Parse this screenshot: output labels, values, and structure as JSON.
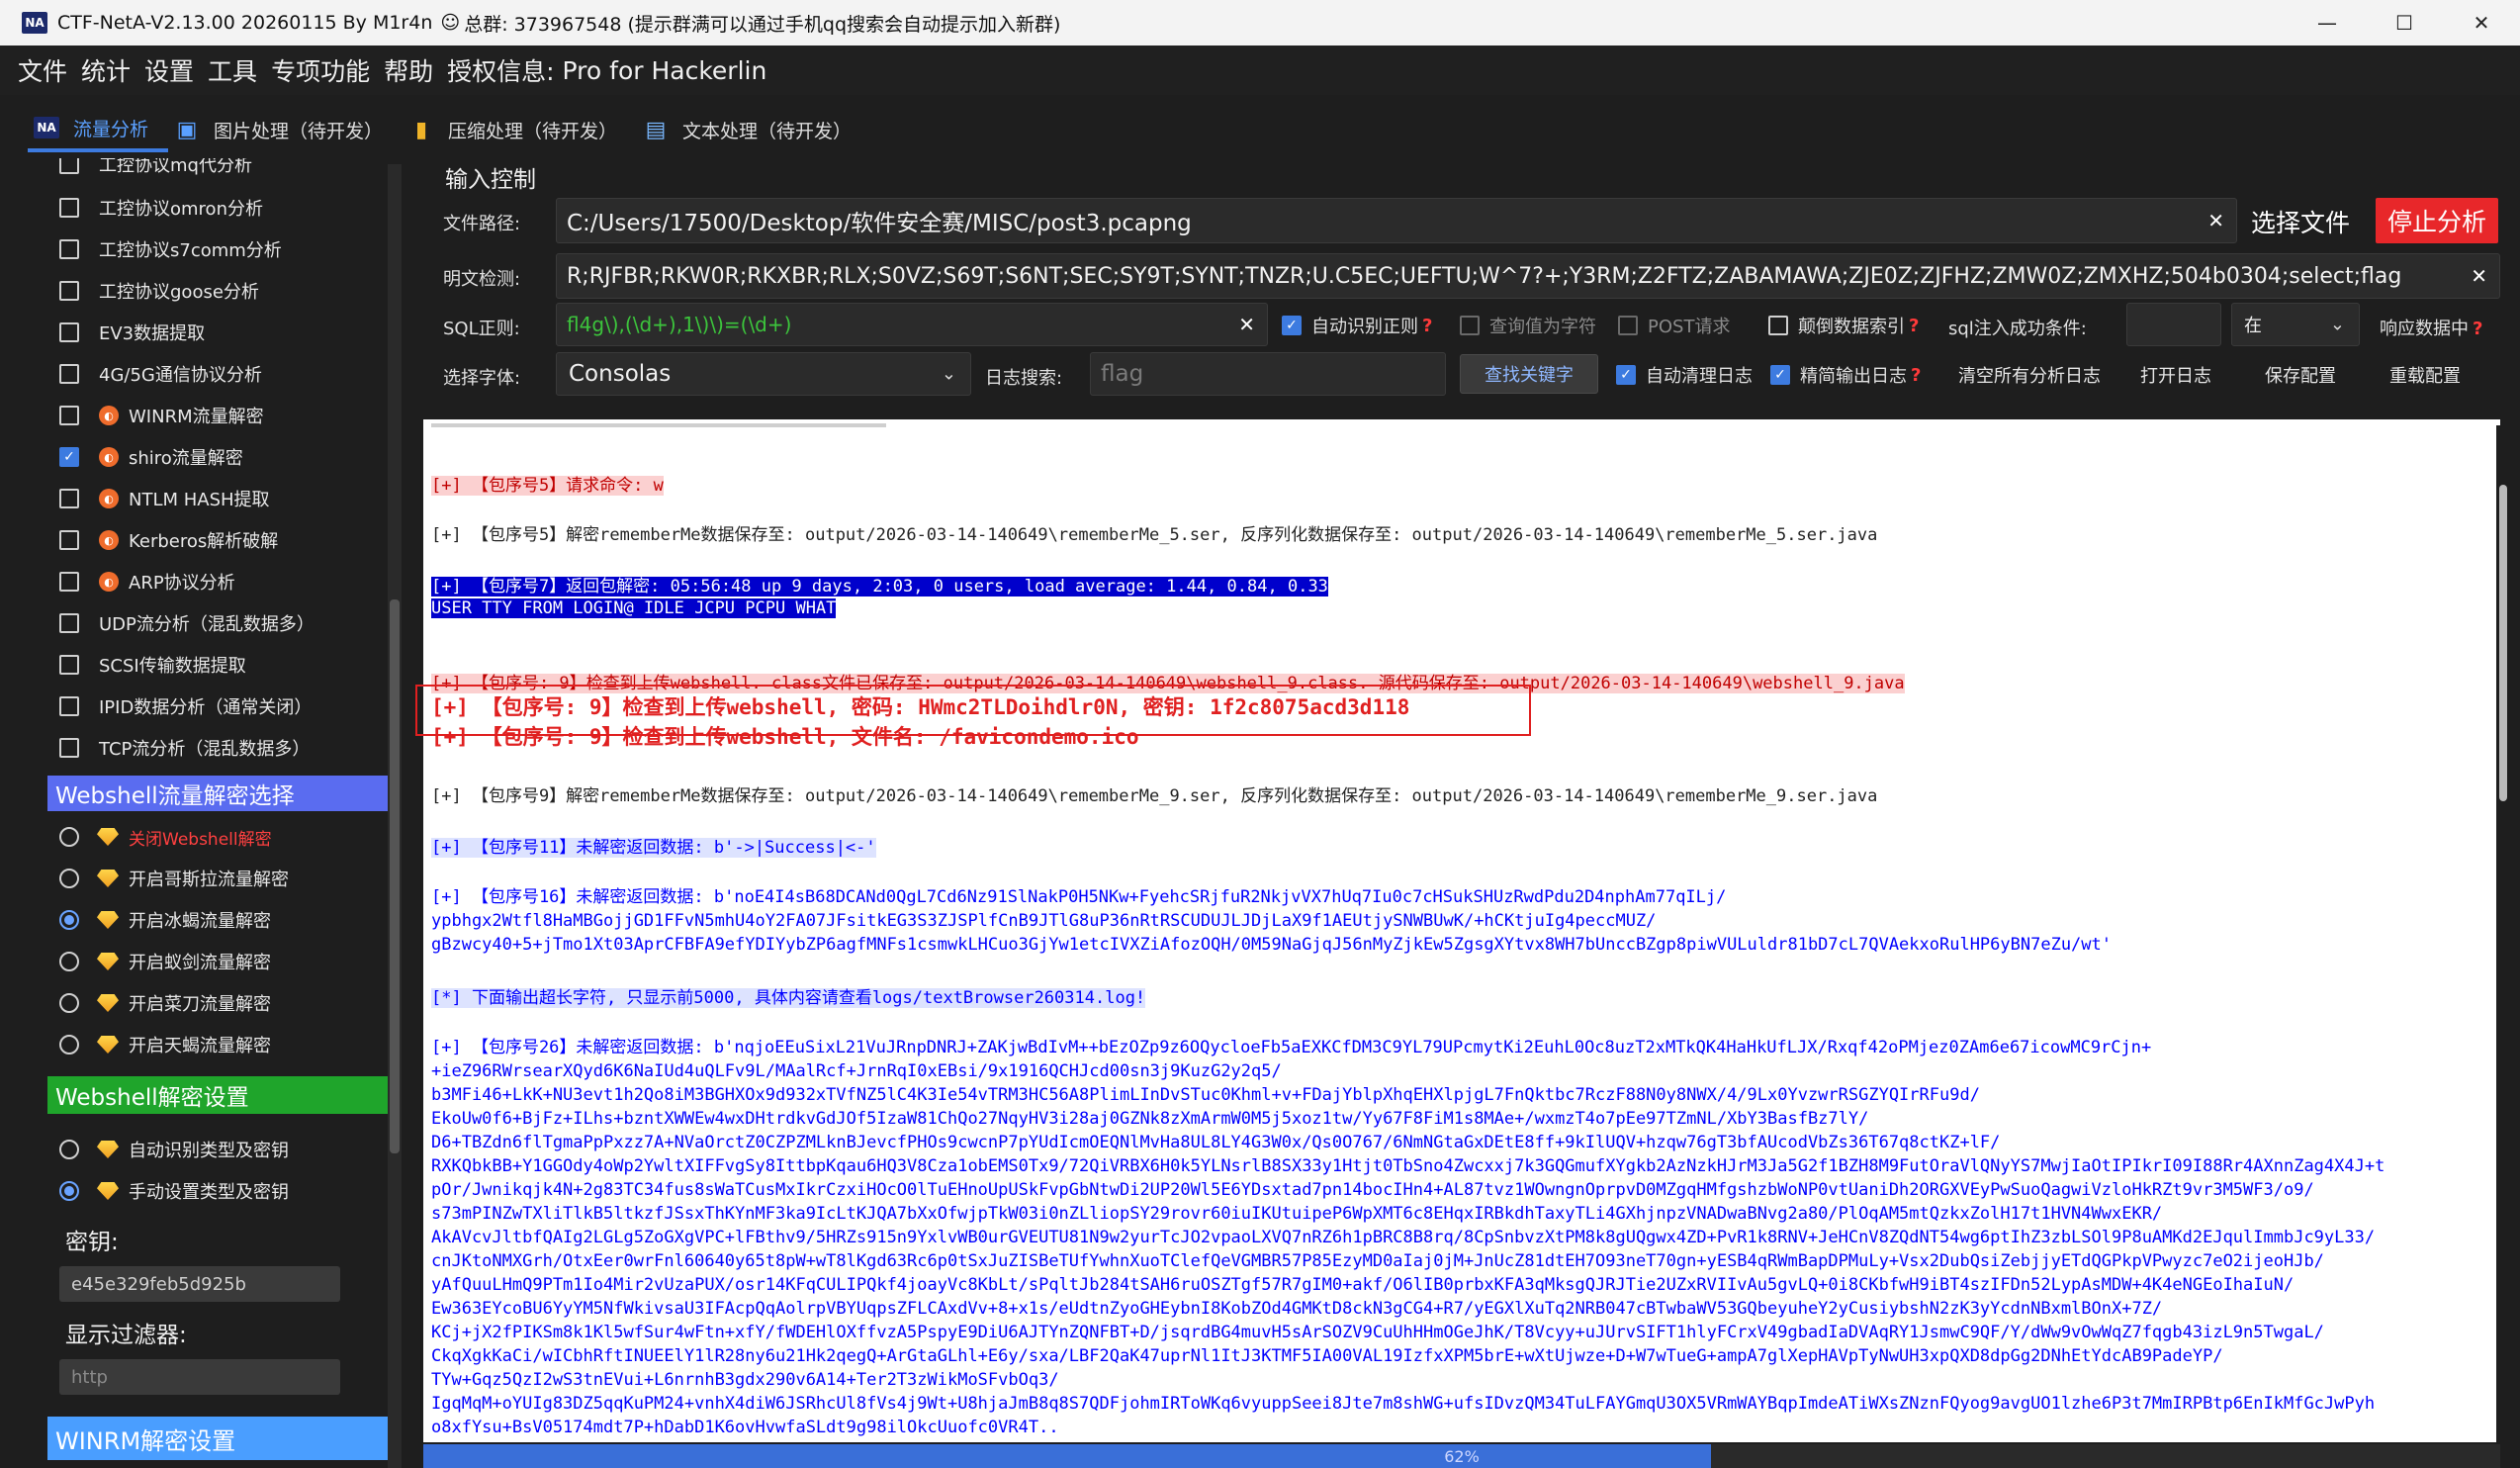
{
  "window": {
    "logo": "NA",
    "title": "CTF-NetA-V2.13.00 20260115 By M1r4n",
    "title_total": "总群: 373967548 (提示群满可以通过手机qq搜索会自动提示加入新群)",
    "minimize": "—",
    "maximize": "☐",
    "close": "✕"
  },
  "menu": [
    "文件",
    "统计",
    "设置",
    "工具",
    "专项功能",
    "帮助",
    "授权信息:",
    "Pro for Hackerlin"
  ],
  "tabs": [
    {
      "icon": "NA",
      "label": "流量分析"
    },
    {
      "icon": "▣",
      "label": "图片处理（待开发）"
    },
    {
      "icon": "▮",
      "label": "压缩处理（待开发）"
    },
    {
      "icon": "▤",
      "label": "文本处理（待开发）"
    }
  ],
  "left": {
    "items": [
      {
        "label": "工控协议mq代分析",
        "checked": false
      },
      {
        "label": "工控协议omron分析",
        "checked": false
      },
      {
        "label": "工控协议s7comm分析",
        "checked": false
      },
      {
        "label": "工控协议goose分析",
        "checked": false
      },
      {
        "label": "EV3数据提取",
        "checked": false
      },
      {
        "label": "4G/5G通信协议分析",
        "checked": false
      },
      {
        "label": "WINRM流量解密",
        "checked": false
      },
      {
        "label": "shiro流量解密",
        "checked": true
      },
      {
        "label": "NTLM HASH提取",
        "checked": false
      },
      {
        "label": "Kerberos解析破解",
        "checked": false
      },
      {
        "label": "ARP协议分析",
        "checked": false
      },
      {
        "label": "UDP流分析（混乱数据多）",
        "checked": false
      },
      {
        "label": "SCSI传输数据提取",
        "checked": false
      },
      {
        "label": "IPID数据分析（通常关闭）",
        "checked": false
      },
      {
        "label": "TCP流分析（混乱数据多）",
        "checked": false
      }
    ],
    "webshell_section": "Webshell流量解密选择",
    "webshell_options": [
      {
        "label": "关闭Webshell解密",
        "on": false
      },
      {
        "label": "开启哥斯拉流量解密",
        "on": false
      },
      {
        "label": "开启冰蝎流量解密",
        "on": true
      },
      {
        "label": "开启蚁剑流量解密",
        "on": false
      },
      {
        "label": "开启菜刀流量解密",
        "on": false
      },
      {
        "label": "开启天蝎流量解密",
        "on": false
      }
    ],
    "decrypt_section": "Webshell解密设置",
    "decrypt_options": [
      {
        "label": "自动识别类型及密钥",
        "on": false
      },
      {
        "label": "手动设置类型及密钥",
        "on": true
      }
    ],
    "key_label": "密钥:",
    "key_value": "e45e329feb5d925b",
    "filter_label": "显示过滤器:",
    "filter_placeholder": "http",
    "winrm_section": "WINRM解密设置"
  },
  "input": {
    "title": "输入控制",
    "path_label": "文件路径:",
    "path_value": "C:/Users/17500/Desktop/软件安全赛/MISC/post3.pcapng",
    "select_file": "选择文件",
    "stop": "停止分析",
    "plain_label": "明文检测:",
    "plain_value": "R;RJFBR;RKW0R;RKXBR;RLX;S0VZ;S69T;S6NT;SEC;SY9T;SYNT;TNZR;U.C5EC;UEFTU;W^7?+;Y3RM;Z2FTZ;ZABAMAWA;ZJE0Z;ZJFHZ;ZMW0Z;ZMXHZ;504b0304;select;flag",
    "sql_label": "SQL正则:",
    "sql_value": "fl4g\\),(\\d+),1\\)\\)=(\\d+)",
    "auto_regex": "自动识别正则",
    "query_char": "查询值为字符",
    "post_req": "POST请求",
    "reverse_idx": "颠倒数据索引",
    "sql_success": "sql注入成功条件:",
    "sql_cond_value": "",
    "sql_in": "在",
    "resp_data": "响应数据中",
    "font_label": "选择字体:",
    "font_value": "Consolas",
    "log_search": "日志搜索:",
    "log_search_placeholder": "flag",
    "find_key": "查找关键字",
    "auto_clear": "自动清理日志",
    "simple_output": "精简输出日志",
    "clear_all": "清空所有分析日志",
    "open_log": "打开日志",
    "save_cfg": "保存配置",
    "reload_cfg": "重载配置"
  },
  "log": {
    "l1": "[+] 【包序号5】请求命令: w",
    "l2": "[+] 【包序号5】解密rememberMe数据保存至: output/2026-03-14-140649\\rememberMe_5.ser, 反序列化数据保存至: output/2026-03-14-140649\\rememberMe_5.ser.java",
    "l3": "[+] 【包序号7】返回包解密:  05:56:48 up 9 days, 2:03, 0 users, load average: 1.44, 0.84, 0.33",
    "l4": "USER TTY FROM LOGIN@ IDLE JCPU PCPU WHAT",
    "l5": "[+] 【包序号: 9】检查到上传webshell. class文件已保存至: output/2026-03-14-140649\\webshell_9.class. 源代码保存至: output/2026-03-14-140649\\webshell_9.java",
    "l6": "[+] 【包序号: 9】检查到上传webshell, 密码: HWmc2TLDoihdlr0N, 密钥:  1f2c8075acd3d118",
    "l7": "[+] 【包序号: 9】检查到上传webshell, 文件名: /favicondemo.ico",
    "l8": "[+] 【包序号9】解密rememberMe数据保存至: output/2026-03-14-140649\\rememberMe_9.ser, 反序列化数据保存至: output/2026-03-14-140649\\rememberMe_9.ser.java",
    "l9": "[+] 【包序号11】未解密返回数据: b'->|Success|<-'",
    "l10": "[+] 【包序号16】未解密返回数据: b'noE4I4sB68DCANd0QgL7Cd6Nz91SlNakP0H5NKw+FyehcSRjfuR2NkjvVX7hUq7Iu0c7cHSukSHUzRwdPdu2D4nphAm77qILj/",
    "l11": "ypbhgx2Wtfl8HaMBGojjGD1FFvN5mhU4oY2FA07JFsitkEG3S3ZJSPlfCnB9JTlG8uP36nRtRSCUDUJLJDjLaX9f1AEUtjySNWBUwK/+hCKtjuIg4peccMUZ/",
    "l12": "gBzwcy40+5+jTmo1Xt03AprCFBFA9efYDIYybZP6agfMNFs1csmwkLHCuo3GjYw1etcIVXZiAfozOQH/0M59NaGjqJ56nMyZjkEw5ZgsgXYtvx8WH7bUnccBZgp8piwVULuldr81bD7cL7QVAekxoRulHP6yBN7eZu/wt'",
    "l13": "[*] 下面输出超长字符, 只显示前5000, 具体内容请查看logs/textBrowser260314.log!",
    "l14": "[+] 【包序号26】未解密返回数据: b'nqjoEEuSixL21VuJRnpDNRJ+ZAKjwBdIvM++bEzOZp9z6OQycloeFb5aEXKCfDM3C9YL79UPcmytKi2EuhL0Oc8uzT2xMTkQK4HaHkUfLJX/Rxqf42oPMjez0ZAm6e67icowMC9rCjn+",
    "l15": "+ieZ96RWrsearXQyd6K6NaIUd4uQLFv9L/MAalRcf+JrnRqI0xEBsi/9x1916QCHJcd00sn3j9KuzG2y2q5/",
    "l16": "b3MFi46+LkK+NU3evt1h2Qo8iM3BGHXOx9d932xTVfNZ5lC4K3Ie54vTRM3HC56A8PlimLInDvSTuc0Khml+v+FDajYblpXhqEHXlpjgL7FnQktbc7RczF88N0y8NWX/4/9Lx0YvzwrRSGZYQIrRFu9d/",
    "l17": "EkoUw0f6+BjFz+ILhs+bzntXWWEw4wxDHtrdkvGdJOf5IzaW81ChQo27NqyHV3i28aj0GZNk8zXmArmW0M5j5xoz1tw/Yy67F8FiM1s8MAe+/wxmzT4o7pEe97TZmNL/XbY3BasfBz7lY/",
    "l18": "D6+TBZdn6flTgmaPpPxzz7A+NVaOrctZ0CZPZMLknBJevcfPHOs9cwcnP7pYUdIcmOEQNlMvHa8UL8LY4G3W0x/Qs0O767/6NmNGtaGxDEtE8ff+9kIlUQV+hzqw76gT3bfAUcodVbZs36T67q8ctKZ+lF/",
    "l19": "RXKQbkBB+Y1GGOdy4oWp2YwltXIFFvgSy8IttbpKqau6HQ3V8Cza1obEMS0Tx9/72QiVRBX6H0k5YLNsrlB8SX33y1Htjt0TbSno4Zwcxxj7k3GQGmufXYgkb2AzNzkHJrM3Ja5G2f1BZH8M9FutOraVlQNyYS7MwjIaOtIPIkrI09I88Rr4AXnnZag4X4J+t",
    "l20": "pOr/Jwnikqjk4N+2g83TC34fus8sWaTCusMxIkrCzxiHOcO0lTuEHnoUpUSkFvpGbNtwDi2UP20Wl5E6YDsxtad7pn14bocIHn4+AL87tvz1WOwngnOprpvD0MZgqHMfgshzbWoNP0vtUaniDh2ORGXVEyPwSuoQagwiVzloHkRZt9vr3M5WF3/o9/",
    "l21": "s73mPINZwTXliTlkB5ltkzfJSsxThKYnMF3ka9IcLtKJQA7bXxOfwjpTkW03i0nZLliopSY29rovr60iuIKUtuipeP6WpXMT6c8EHqxIRBkdhTaxyTLi4GXhjnpzVNADwaBNvg2a80/PlOqAM5mtQzkxZolH17t1HVN4WwxEKR/",
    "l22": "AkAVcvJltbfQAIg2LGLg5ZoGXgVPC+lFBthv9/5HRZs915n9YxlvWB0urGVEUTU81N9w2yurTcJO2vpaoLXVQ7nRZ6h1pBRC8B8rq/8CpSnbvzXtPM8k8gUQgwx4ZD+PvR1k8RNV+JeHCnV8ZQdNT54wg6ptIhZ3zbLSOl9P8uAMKd2EJqulImmbJc9yL33/",
    "l23": "cnJKtoNMXGrh/OtxEer0wrFnl60640y65t8pW+wT8lKgd63Rc6p0tSxJuZISBeTUfYwhnXuoTClefQeVGMBR57P85EzyMD0aIaj0jM+JnUcZ81dtEH7O93neT70gn+yESB4qRWmBapDPMuLy+Vsx2DubQsiZebjjyETdQGPkpVPwyzc7eO2ijeoHJb/",
    "l24": "yAfQuuLHmQ9PTm1Io4Mir2vUzaPUX/osr14KFqCULIPQkf4joayVc8KbLt/sPqltJb284tSAH6ruOSZTgf57R7gIM0+akf/O6lIB0prbxKFA3qMksgQJRJTie2UZxRVIIvAu5gvLQ+0i8CKbfwH9iBT4szIFDn52LypAsMDW+4K4eNGEoIhaIuN/",
    "l25": "Ew363EYcoBU6YyYM5NfWkivsaU3IFAcpQqAolrpVBYUqpsZFLCAxdVv+8+x1s/eUdtnZyoGHEybnI8KobZOd4GMKtD8ckN3gCG4+R7/yEGXlXuTq2NRB047cBTwbaWV53GQbeyuheY2yCusiybshN2zK3yYcdnNBxmlBOnX+7Z/",
    "l26": "KCj+jX2fPIKSm8k1Kl5wfSur4wFtn+xfY/fWDEHlOXffvzA5PspyE9DiU6AJTYnZQNFBT+D/jsqrdBG4muvH5sArSOZV9CuUhHHmOGeJhK/T8Vcyy+uJUrvSIFT1hlyFCrxV49gbadIaDVAqRY1JsmwC9QF/Y/dWw9vOwWqZ7fqgb43izL9n5TwgaL/",
    "l27": "CkqXgkKaCi/wICbhRftINUEElY1lR28ny6u21Hk2qegQ+ArGtaGLhl+E6y/sxa/LBF2QaK47uprNl1ItJ3KTMF5IA00VAL19IzfxXPM5brE+wXtUjwze+D+W7wTueG+ampA7glXepHAVpTyNwUH3xpQXD8dpGg2DNhEtYdcAB9PadeYP/",
    "l28": "TYw+Gqz5QzI2wS3tnEVui+L6nrnhB3gdx290v6A14+Ter2T3zWikMoSFvbOq3/",
    "l29": "IgqMqM+oYUIg83DZ5qqKuPM24+vnhX4diW6JSRhcUl8fVs4j9Wt+U8hjaJmB8q8S7QDFjohmIRToWKq6vyuppSeei8Jte7m8shWG+ufsIDvzQM34TuLFAYGmqU3OX5VRmWAYBqpImdeATiWXsZNznFQyog9avgUO1lzhe6P3t7MmIRPBtp6EnIkMfGcJwPyh",
    "l30": "o8xfYsu+BsV05174mdt7P+hDabD1K6ovHvwfaSLdt9g98ilOkcUuofc0VR4T.. "
  },
  "progress": {
    "value": 0.62,
    "label": "62%"
  },
  "colors": {
    "accent": "#3d7be0",
    "stop_red": "#e8272a",
    "section_blue": "#5a6cf0",
    "section_green": "#1fa52b",
    "section_lightblue": "#4a9eff"
  }
}
